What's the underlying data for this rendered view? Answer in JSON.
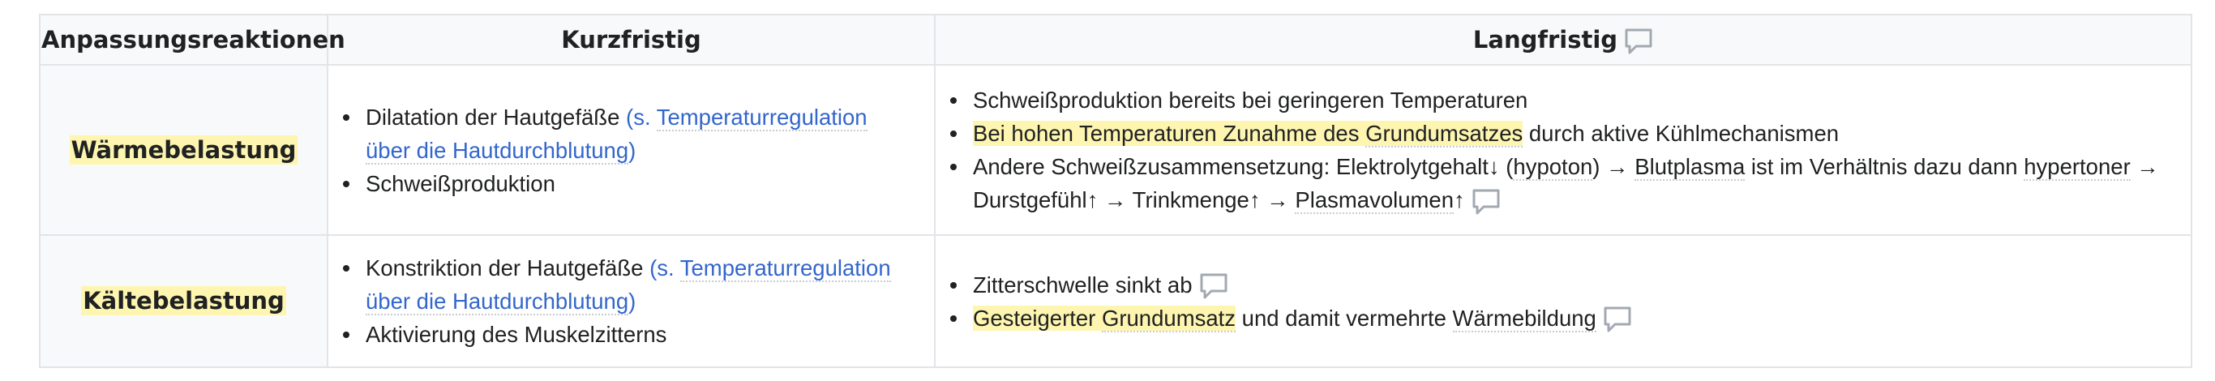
{
  "table": {
    "headers": [
      "Anpassungsreaktionen",
      "Kurzfristig",
      "Langfristig"
    ],
    "rows": [
      {
        "label": "Wärmebelastung",
        "short": {
          "item1_text": "Dilatation der Hautgefäße",
          "item1_ref_open": "(s. ",
          "item1_ref_link": "Temperaturregulation über die Hautdurchblutung",
          "item1_ref_close": ")",
          "item2": "Schweißproduktion"
        },
        "long": {
          "item1": "Schweißproduktion bereits bei geringeren Temperaturen",
          "item2_hl_a": "Bei hohen Temperaturen Zunahme des ",
          "item2_hl_link": "Grundumsatzes",
          "item2_rest": " durch aktive Kühlmechanismen",
          "item3_a": "Andere Schweißzusammensetzung: Elektrolytgehalt↓ (",
          "item3_link1": "hypoton",
          "item3_b": ") → ",
          "item3_link2": "Blutplasma",
          "item3_c": " ist im Verhältnis dazu dann ",
          "item3_link3": "hypertoner",
          "item3_d": " → Durstgefühl↑ → Trinkmenge↑ → ",
          "item3_link4": "Plasmavolumen",
          "item3_e": "↑"
        }
      },
      {
        "label": "Kältebelastung",
        "short": {
          "item1_text": "Konstriktion der Hautgefäße",
          "item1_ref_open": "(s. ",
          "item1_ref_link": "Temperaturregulation über die Hautdurchblutung",
          "item1_ref_close": ")",
          "item2": "Aktivierung des Muskelzitterns"
        },
        "long": {
          "item1": "Zitterschwelle sinkt ab",
          "item2_hl": "Gesteigerter ",
          "item2_hl_link": "Grundumsatz",
          "item2_a": " und damit vermehrte ",
          "item2_link": "Wärmebildung"
        }
      }
    ]
  },
  "icons": {
    "comment": "comment-icon"
  },
  "colors": {
    "highlight": "#fdf5b0",
    "link": "#3366cc",
    "header_bg": "#f8f9fa",
    "border": "#e2e4e8",
    "icon": "#a2a9b1"
  }
}
